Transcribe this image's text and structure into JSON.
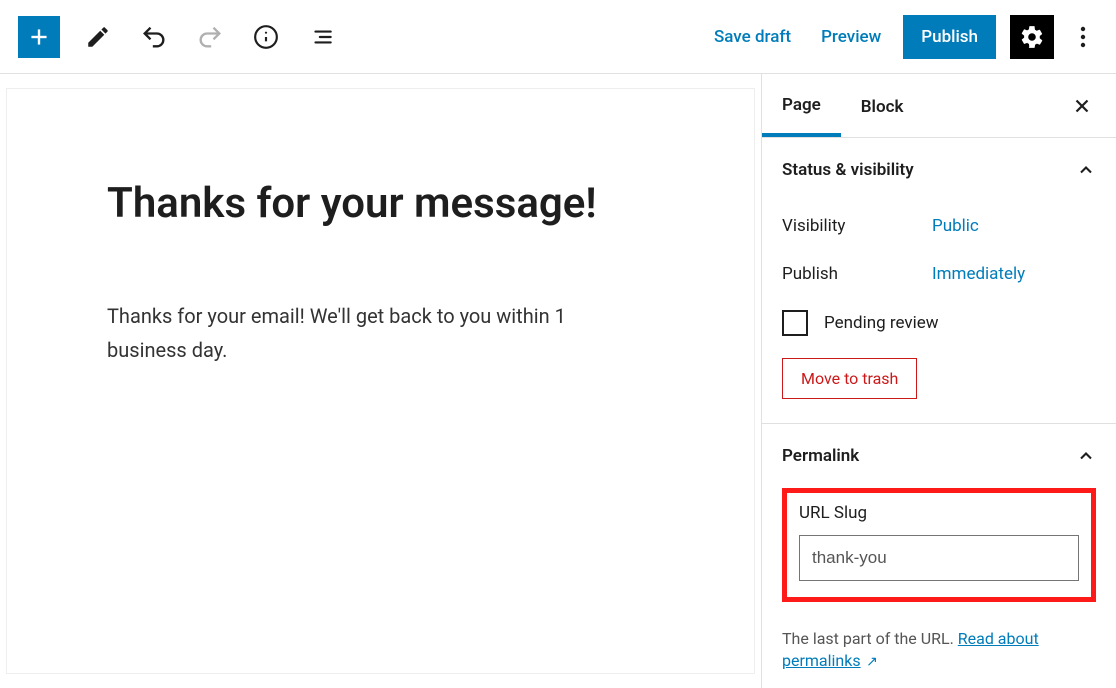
{
  "toolbar": {
    "save_draft": "Save draft",
    "preview": "Preview",
    "publish": "Publish"
  },
  "editor": {
    "title": "Thanks for your message!",
    "body": "Thanks for your email! We'll get back to you within 1 business day."
  },
  "sidebar": {
    "tabs": {
      "page": "Page",
      "block": "Block"
    },
    "status": {
      "title": "Status & visibility",
      "visibility_label": "Visibility",
      "visibility_value": "Public",
      "publish_label": "Publish",
      "publish_value": "Immediately",
      "pending_label": "Pending review",
      "trash_label": "Move to trash"
    },
    "permalink": {
      "title": "Permalink",
      "slug_label": "URL Slug",
      "slug_value": "thank-you",
      "help_pre": "The last part of the URL. ",
      "help_link": "Read about permalinks"
    }
  }
}
